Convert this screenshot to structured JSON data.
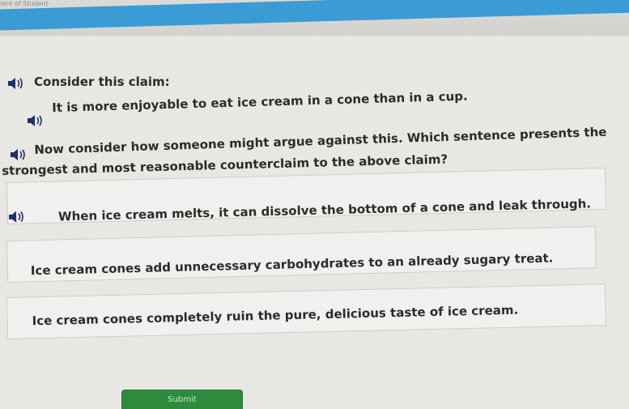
{
  "header": {
    "partial_text": "ient of Student"
  },
  "question": {
    "intro": "Consider this claim:",
    "claim": "It is more enjoyable to eat ice cream in a cone than in a cup.",
    "prompt_line1": "Now consider how someone might argue against this. Which sentence presents the",
    "prompt_line2": "strongest and most reasonable counterclaim to the above claim?"
  },
  "choices": [
    {
      "label": "When ice cream melts, it can dissolve the bottom of a cone and leak through."
    },
    {
      "label": "Ice cream cones add unnecessary carbohydrates to an already sugary treat."
    },
    {
      "label": "Ice cream cones completely ruin the pure, delicious taste of ice cream."
    }
  ],
  "submit": {
    "label": "Submit"
  },
  "icons": {
    "audio": "speaker-icon"
  },
  "colors": {
    "accent_blue": "#3a9bd5",
    "submit_green": "#2e8b3e"
  }
}
